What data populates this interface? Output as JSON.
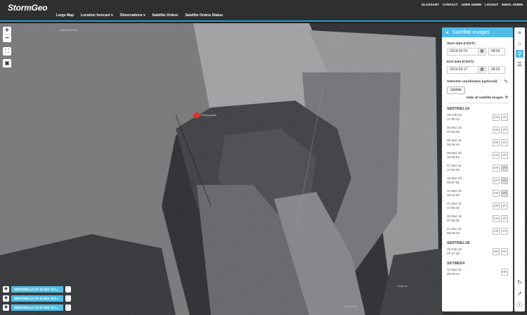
{
  "app": {
    "logo": "StormGeo"
  },
  "toplinks": [
    "GLOSSARY",
    "CONTACT",
    "USER ADMIN",
    "LOGOUT",
    "EMAIL ADMIN"
  ],
  "nav": {
    "large_map": "Large Map",
    "location_forecast": "Location forecast",
    "observations": "Observations",
    "satellite_orders": "Satellite Orders",
    "satellite_orders_status": "Satellite Orders Status"
  },
  "map": {
    "zoom_in": "+",
    "zoom_out": "−",
    "place_labels": [
      "Akimiski Island",
      "Povungnituk",
      "Inukjuak",
      "Puvirnituq"
    ],
    "layers": [
      "SENTINEL1A VV 10 Mar 19 1...",
      "SENTINEL1A VV 10 Mar 19 0...",
      "SENTINEL1A VV 07 Mar 19 1..."
    ]
  },
  "panel": {
    "title": "Satellite images",
    "start_label": "Start date (CEST):",
    "start_date": "2019-02-01",
    "start_time": "08:02",
    "end_label": "End date (CEST):",
    "end_date": "2019-03-17",
    "end_time": "08:02",
    "coords_label": "Selected coordinates (optional)",
    "update_label": "Update",
    "hide_all_label": "Hide all satellite images",
    "groups": [
      {
        "name": "SENTINEL1A",
        "images": [
          {
            "date": "28 Feb 19",
            "time": "17:58:43",
            "pols": [
              "VH",
              "VV"
            ],
            "active": []
          },
          {
            "date": "03 Mar 19",
            "time": "07:06:06",
            "pols": [
              "VH",
              "VV"
            ],
            "active": []
          },
          {
            "date": "05 Mar 19",
            "time": "06:49:44",
            "pols": [
              "VH",
              "VV"
            ],
            "active": []
          },
          {
            "date": "05 Mar 19",
            "time": "18:06:54",
            "pols": [
              "VH",
              "VV"
            ],
            "active": []
          },
          {
            "date": "07 Mar 19",
            "time": "17:50:33",
            "pols": [
              "VH",
              "VV"
            ],
            "active": [
              "VV"
            ]
          },
          {
            "date": "10 Mar 19",
            "time": "06:57:55",
            "pols": [
              "VH",
              "VV"
            ],
            "active": [
              "VV"
            ]
          },
          {
            "date": "10 Mar 19",
            "time": "18:15:02",
            "pols": [
              "VH",
              "VV"
            ],
            "active": [
              "VV"
            ]
          },
          {
            "date": "12 Mar 19",
            "time": "17:58:42",
            "pols": [
              "VH",
              "VV"
            ],
            "active": []
          },
          {
            "date": "15 Mar 19",
            "time": "07:06:06",
            "pols": [
              "VH",
              "VV"
            ],
            "active": []
          },
          {
            "date": "17 Mar 19",
            "time": "06:49:43",
            "pols": [
              "VH",
              "VV"
            ],
            "active": []
          }
        ]
      },
      {
        "name": "SENTINEL1B",
        "images": [
          {
            "date": "25 Feb 19",
            "time": "07:07:26",
            "pols": [
              "HH",
              "HV"
            ],
            "active": []
          }
        ]
      },
      {
        "name": "SKYMED4",
        "images": [
          {
            "date": "14 Mar 19",
            "time": "06:09:44",
            "pols": [
              "HH"
            ],
            "active": []
          }
        ]
      }
    ]
  },
  "colors": {
    "accent": "#4fbde6",
    "topbar": "#2d2f31",
    "marker": "#e8322b"
  }
}
